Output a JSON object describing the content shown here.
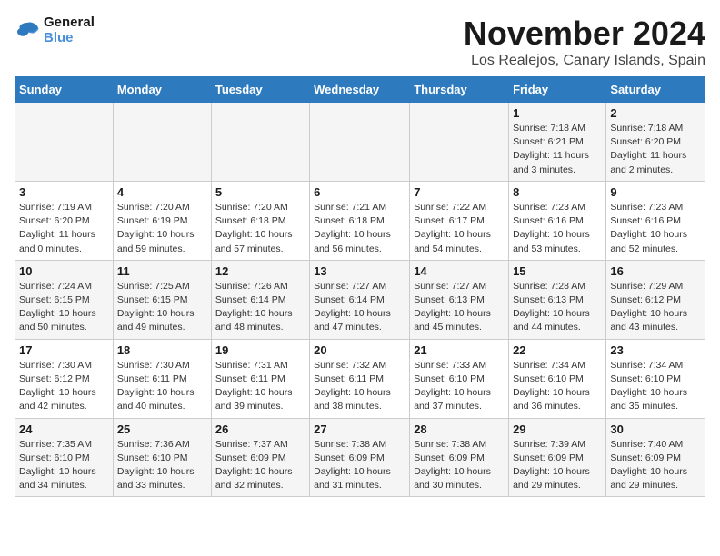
{
  "logo": {
    "line1": "General",
    "line2": "Blue"
  },
  "title": "November 2024",
  "location": "Los Realejos, Canary Islands, Spain",
  "headers": [
    "Sunday",
    "Monday",
    "Tuesday",
    "Wednesday",
    "Thursday",
    "Friday",
    "Saturday"
  ],
  "weeks": [
    [
      {
        "day": "",
        "info": ""
      },
      {
        "day": "",
        "info": ""
      },
      {
        "day": "",
        "info": ""
      },
      {
        "day": "",
        "info": ""
      },
      {
        "day": "",
        "info": ""
      },
      {
        "day": "1",
        "info": "Sunrise: 7:18 AM\nSunset: 6:21 PM\nDaylight: 11 hours and 3 minutes."
      },
      {
        "day": "2",
        "info": "Sunrise: 7:18 AM\nSunset: 6:20 PM\nDaylight: 11 hours and 2 minutes."
      }
    ],
    [
      {
        "day": "3",
        "info": "Sunrise: 7:19 AM\nSunset: 6:20 PM\nDaylight: 11 hours and 0 minutes."
      },
      {
        "day": "4",
        "info": "Sunrise: 7:20 AM\nSunset: 6:19 PM\nDaylight: 10 hours and 59 minutes."
      },
      {
        "day": "5",
        "info": "Sunrise: 7:20 AM\nSunset: 6:18 PM\nDaylight: 10 hours and 57 minutes."
      },
      {
        "day": "6",
        "info": "Sunrise: 7:21 AM\nSunset: 6:18 PM\nDaylight: 10 hours and 56 minutes."
      },
      {
        "day": "7",
        "info": "Sunrise: 7:22 AM\nSunset: 6:17 PM\nDaylight: 10 hours and 54 minutes."
      },
      {
        "day": "8",
        "info": "Sunrise: 7:23 AM\nSunset: 6:16 PM\nDaylight: 10 hours and 53 minutes."
      },
      {
        "day": "9",
        "info": "Sunrise: 7:23 AM\nSunset: 6:16 PM\nDaylight: 10 hours and 52 minutes."
      }
    ],
    [
      {
        "day": "10",
        "info": "Sunrise: 7:24 AM\nSunset: 6:15 PM\nDaylight: 10 hours and 50 minutes."
      },
      {
        "day": "11",
        "info": "Sunrise: 7:25 AM\nSunset: 6:15 PM\nDaylight: 10 hours and 49 minutes."
      },
      {
        "day": "12",
        "info": "Sunrise: 7:26 AM\nSunset: 6:14 PM\nDaylight: 10 hours and 48 minutes."
      },
      {
        "day": "13",
        "info": "Sunrise: 7:27 AM\nSunset: 6:14 PM\nDaylight: 10 hours and 47 minutes."
      },
      {
        "day": "14",
        "info": "Sunrise: 7:27 AM\nSunset: 6:13 PM\nDaylight: 10 hours and 45 minutes."
      },
      {
        "day": "15",
        "info": "Sunrise: 7:28 AM\nSunset: 6:13 PM\nDaylight: 10 hours and 44 minutes."
      },
      {
        "day": "16",
        "info": "Sunrise: 7:29 AM\nSunset: 6:12 PM\nDaylight: 10 hours and 43 minutes."
      }
    ],
    [
      {
        "day": "17",
        "info": "Sunrise: 7:30 AM\nSunset: 6:12 PM\nDaylight: 10 hours and 42 minutes."
      },
      {
        "day": "18",
        "info": "Sunrise: 7:30 AM\nSunset: 6:11 PM\nDaylight: 10 hours and 40 minutes."
      },
      {
        "day": "19",
        "info": "Sunrise: 7:31 AM\nSunset: 6:11 PM\nDaylight: 10 hours and 39 minutes."
      },
      {
        "day": "20",
        "info": "Sunrise: 7:32 AM\nSunset: 6:11 PM\nDaylight: 10 hours and 38 minutes."
      },
      {
        "day": "21",
        "info": "Sunrise: 7:33 AM\nSunset: 6:10 PM\nDaylight: 10 hours and 37 minutes."
      },
      {
        "day": "22",
        "info": "Sunrise: 7:34 AM\nSunset: 6:10 PM\nDaylight: 10 hours and 36 minutes."
      },
      {
        "day": "23",
        "info": "Sunrise: 7:34 AM\nSunset: 6:10 PM\nDaylight: 10 hours and 35 minutes."
      }
    ],
    [
      {
        "day": "24",
        "info": "Sunrise: 7:35 AM\nSunset: 6:10 PM\nDaylight: 10 hours and 34 minutes."
      },
      {
        "day": "25",
        "info": "Sunrise: 7:36 AM\nSunset: 6:10 PM\nDaylight: 10 hours and 33 minutes."
      },
      {
        "day": "26",
        "info": "Sunrise: 7:37 AM\nSunset: 6:09 PM\nDaylight: 10 hours and 32 minutes."
      },
      {
        "day": "27",
        "info": "Sunrise: 7:38 AM\nSunset: 6:09 PM\nDaylight: 10 hours and 31 minutes."
      },
      {
        "day": "28",
        "info": "Sunrise: 7:38 AM\nSunset: 6:09 PM\nDaylight: 10 hours and 30 minutes."
      },
      {
        "day": "29",
        "info": "Sunrise: 7:39 AM\nSunset: 6:09 PM\nDaylight: 10 hours and 29 minutes."
      },
      {
        "day": "30",
        "info": "Sunrise: 7:40 AM\nSunset: 6:09 PM\nDaylight: 10 hours and 29 minutes."
      }
    ]
  ]
}
